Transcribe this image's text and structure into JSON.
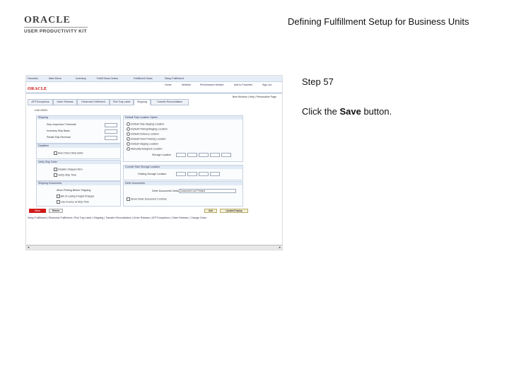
{
  "brand": {
    "logo_top": "ORACLE",
    "logo_bottom": "USER PRODUCTIVITY KIT"
  },
  "doc_title": "Defining Fulfillment Setup for Business Units",
  "step": {
    "label": "Step 57"
  },
  "instruction": {
    "prefix": "Click the ",
    "target": "Save",
    "suffix": " button."
  },
  "screenshot": {
    "top_nav": [
      "Favorites",
      "Main Menu",
      "Inventory",
      "Fulfill Stock Orders",
      "Fulfillment Rules",
      "Setup Fulfillment"
    ],
    "top_links": [
      "Home",
      "Worklist",
      "Performance Monitor",
      "Add to Favorites",
      "Sign out"
    ],
    "oracle": "ORACLE",
    "help_bar": "New Window | Help | Personalize Page",
    "tabs": [
      "ATP Exceptions",
      "Order Release",
      "Electronic Fulfillment",
      "Pick Tray Label",
      "Shipping",
      "Transfer Reconciliation"
    ],
    "active_tab": 4,
    "unit_label": "Unit US001",
    "panels": {
      "shipping": {
        "title": "Shipping",
        "fields": [
          "Ship Inspection Threshold",
          "Inventory Ship Basis",
          "Partial Ship Reversal"
        ]
      },
      "depletion": {
        "title": "Depletion",
        "fields": [
          "Auto Direct Ship Defer"
        ]
      },
      "verify": {
        "title": "Verify Ship Defer",
        "fields": [
          "Deplete Shipped Item",
          "Verify Ship Time"
        ]
      },
      "ship_docs": {
        "title": "Shipping Documents",
        "fields": [
          "Allow Printing Before Shipping",
          "Bill of Lading Freight Charges",
          "Use Invoice at Ship Time"
        ]
      },
      "default_location": {
        "title": "Default Ship Location Option",
        "options": [
          "Default Ship Staging Location",
          "Default Picking/Staging Location",
          "Default Delivery Location",
          "Default Fixed Packing Location",
          "Default Staging Location",
          "Manually Assigned Location"
        ],
        "storage_label": "Storage Location"
      },
      "counter_sale": {
        "title": "Counter Sale Storage Location",
        "field": "Holding Storage Location"
      },
      "defer_docs": {
        "title": "Defer Documents",
        "select_label": "Defer Documents Default",
        "select_value": "Document not Printed",
        "checkbox": "Show Defer Document Controls"
      }
    },
    "buttons": {
      "save": "Save",
      "return": "Return",
      "add": "Add",
      "update": "Update/Display"
    },
    "footer_links": "Setup Fulfillment | Electronic Fulfillment | Pick Tray Label | Shipping | Transfer Reconciliation | Order Release | ATP Exceptions | Order Release | Change Order"
  }
}
